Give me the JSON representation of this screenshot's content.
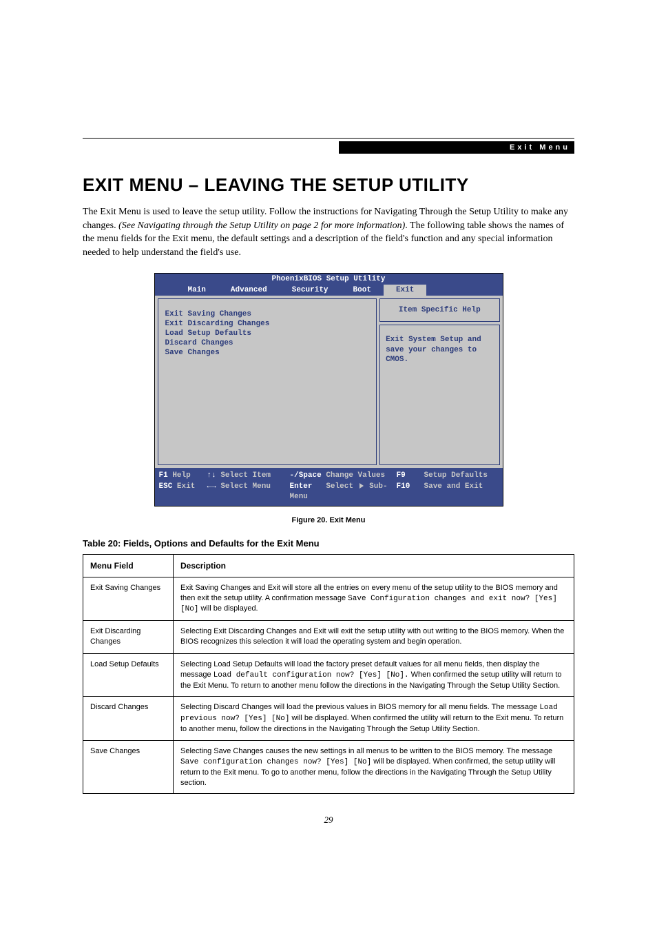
{
  "header": {
    "breadcrumb": "Exit Menu"
  },
  "title": "EXIT MENU – LEAVING THE SETUP UTILITY",
  "intro": {
    "p1a": "The Exit Menu is used to leave the setup utility. Follow the instructions for Navigating Through the Setup Utility to make any changes. ",
    "p1_italic": "(See Navigating through the Setup Utility on page 2 for more information)",
    "p1b": ". The following table shows the names of the menu fields for the Exit menu, the default settings and a description of the field's function and any special information needed to help understand the field's use."
  },
  "bios": {
    "title": "PhoenixBIOS Setup Utility",
    "tabs": {
      "main": "Main",
      "advanced": "Advanced",
      "security": "Security",
      "boot": "Boot",
      "exit": "Exit"
    },
    "items": {
      "exit_saving": "Exit Saving Changes",
      "exit_discarding": "Exit Discarding Changes",
      "load_defaults": "Load Setup Defaults",
      "discard": "Discard Changes",
      "save": "Save Changes"
    },
    "help_title": "Item Specific Help",
    "help_body": "Exit System Setup and save your changes to CMOS.",
    "footer": {
      "f1_key": "F1",
      "f1_label": "Help",
      "arrows_ud": "↑↓",
      "select_item": "Select Item",
      "minus_space": "-/Space",
      "change_values": "Change Values",
      "f9_key": "F9",
      "f9_label": "Setup Defaults",
      "esc_key": "ESC",
      "esc_label": "Exit",
      "arrows_lr": "←→",
      "select_menu": "Select Menu",
      "enter_key": "Enter",
      "select_sub": "Select",
      "sub_menu": "Sub-Menu",
      "f10_key": "F10",
      "f10_label": "Save and Exit"
    }
  },
  "figure_caption": "Figure 20.   Exit Menu",
  "table_title": "Table 20: Fields, Options and Defaults for the Exit Menu",
  "table": {
    "headers": {
      "menu_field": "Menu Field",
      "description": "Description"
    },
    "rows": [
      {
        "field": "Exit Saving Changes",
        "desc_a": "Exit Saving Changes and Exit will store all the entries on every menu of the setup utility to the BIOS memory and then exit the setup utility. A confirmation message ",
        "code": "Save Configuration changes and exit now? [Yes] [No]",
        "desc_b": " will be displayed."
      },
      {
        "field": "Exit Discarding Changes",
        "desc_a": "Selecting Exit Discarding Changes and Exit will exit the setup utility with out writing to the BIOS memory. When the BIOS recognizes this selection it will load the operating system and begin operation.",
        "code": "",
        "desc_b": ""
      },
      {
        "field": "Load Setup Defaults",
        "desc_a": "Selecting Load Setup Defaults will load the factory preset default values for all menu fields, then display the message ",
        "code": "Load default configuration now? [Yes] [No].",
        "desc_b": " When confirmed the setup utility will return to the Exit Menu. To return to another menu follow the directions in the Navigating Through the Setup Utility Section."
      },
      {
        "field": "Discard Changes",
        "desc_a": "Selecting Discard Changes will load the previous values in BIOS memory for all menu fields. The message ",
        "code": "Load previous now? [Yes] [No]",
        "desc_b": " will be displayed. When confirmed the utility will return to the Exit menu. To return to another menu, follow the directions in the Navigating Through the Setup Utility Section."
      },
      {
        "field": "Save Changes",
        "desc_a": "Selecting Save Changes causes the new settings in all menus to be written to the BIOS memory. The message ",
        "code": "Save configuration changes now? [Yes] [No]",
        "desc_b": " will be displayed. When confirmed, the setup utility will return to the Exit menu. To go to another menu, follow the directions in the Navigating Through the Setup Utility section."
      }
    ]
  },
  "page_number": "29"
}
